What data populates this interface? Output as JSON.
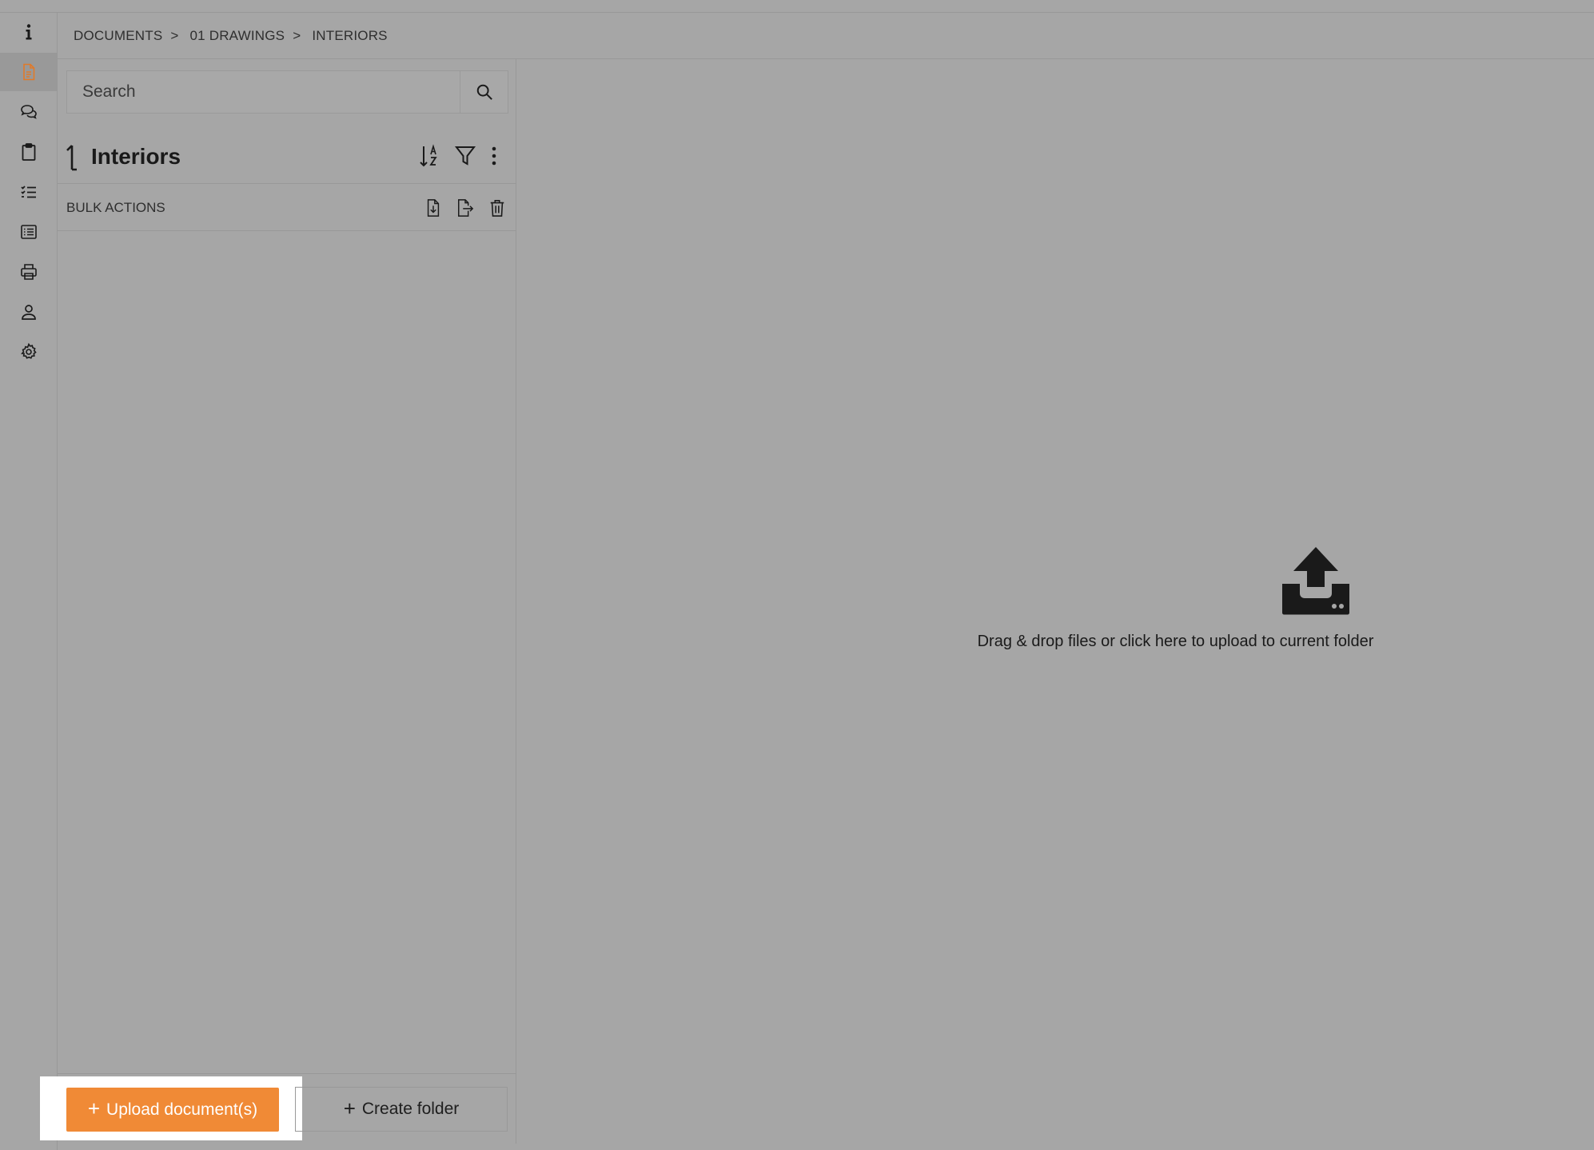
{
  "breadcrumb": {
    "items": [
      "DOCUMENTS",
      "01 DRAWINGS",
      "INTERIORS"
    ],
    "separator": ">"
  },
  "rail": {
    "items": [
      {
        "icon": "info-icon"
      },
      {
        "icon": "document-icon",
        "active": true
      },
      {
        "icon": "chat-icon"
      },
      {
        "icon": "clipboard-icon"
      },
      {
        "icon": "checklist-icon"
      },
      {
        "icon": "list-icon"
      },
      {
        "icon": "printer-icon"
      },
      {
        "icon": "user-icon"
      },
      {
        "icon": "gear-icon"
      }
    ]
  },
  "search": {
    "placeholder": "Search"
  },
  "folder": {
    "title": "Interiors"
  },
  "bulk": {
    "label": "BULK ACTIONS"
  },
  "buttons": {
    "upload_label": "Upload document(s)",
    "create_folder_label": "Create folder",
    "plus": "+"
  },
  "dropzone": {
    "text": "Drag & drop files or click here to upload to current folder"
  },
  "colors": {
    "accent": "#f08a36",
    "background": "#a6a6a6",
    "active_rail": "#999999"
  }
}
